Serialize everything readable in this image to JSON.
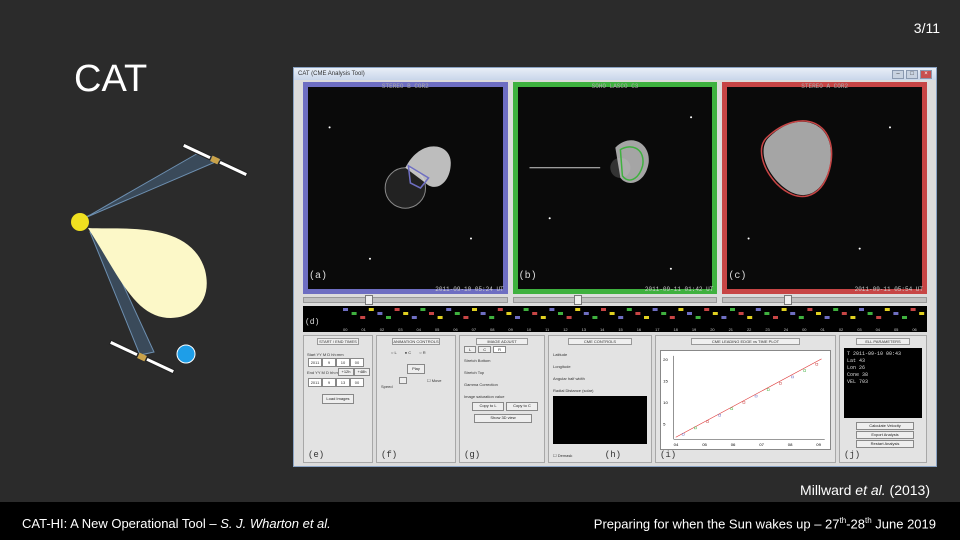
{
  "slide": {
    "number": "3/11",
    "title": "CAT"
  },
  "app": {
    "window_title": "CAT (CME Analysis Tool)",
    "panels": [
      {
        "title": "STEREO B COR2",
        "label": "(a)",
        "date": "2011-09-10 05:24 UT",
        "color": "#6e6ec2"
      },
      {
        "title": "SOHO LASCO C3",
        "label": "(b)",
        "date": "2011-09-11 01:42 UT",
        "color": "#3fb13f"
      },
      {
        "title": "STEREO A COR2",
        "label": "(c)",
        "date": "2011-09-11 05:54 UT",
        "color": "#c74545"
      }
    ],
    "timeline_label": "(d)",
    "timeline_ticks": [
      "00",
      "01",
      "02",
      "03",
      "04",
      "05",
      "06",
      "07",
      "08",
      "09",
      "10",
      "11",
      "12",
      "13",
      "14",
      "15",
      "16",
      "17",
      "18",
      "19",
      "20",
      "21",
      "22",
      "23",
      "24",
      "00",
      "01",
      "02",
      "03",
      "04",
      "05",
      "06"
    ],
    "controls": {
      "start_end": {
        "header": "START / END TIMES",
        "label": "(e)",
        "start_label": "Start YY M D hh:mm",
        "end_label": "End YY M D hh:mm",
        "start_values": [
          "2011",
          "9",
          "10",
          "00"
        ],
        "end_values": [
          "2011",
          "9",
          "13",
          "00"
        ],
        "btn1": "+12h",
        "btn2": "+48h",
        "load_button": "Load Images"
      },
      "animation": {
        "header": "ANIMATION CONTROLS",
        "label": "(f)",
        "radio_l": "L",
        "radio_c": "C",
        "radio_r": "R",
        "play_button": "Play",
        "speed_label": "Speed",
        "check_label": "Move"
      },
      "image_adjust": {
        "header": "IMAGE ADJUST",
        "label": "(g)",
        "tabs": [
          "L",
          "C",
          "R"
        ],
        "stretch_bottom": "Stretch Bottom",
        "stretch_top": "Stretch Top",
        "gamma": "Gamma Correction",
        "saturation": "Image saturation value",
        "copy_l": "Copy to L",
        "copy_c": "Copy to C",
        "show_3d": "Show 3D view"
      },
      "cme_controls": {
        "header": "CME CONTROLS",
        "label": "(h)",
        "latitude": "Latitude",
        "longitude": "Longitude",
        "half_angle": "Angular half width",
        "distance": "Radial Distance (solar)",
        "check_label": "Demask"
      },
      "plot": {
        "header": "CME LEADING EDGE vs TIME PLOT",
        "label": "(i)",
        "x_ticks": [
          "04",
          "05",
          "06",
          "07",
          "08",
          "09"
        ],
        "y_ticks": [
          "20",
          "15",
          "10",
          "5"
        ]
      },
      "ellipse": {
        "header": "ELL PARAMETERS",
        "label": "(j)",
        "lines": [
          "T  2011-09-10 00:43",
          "Lat  43",
          "Lon  26",
          "Cone  38",
          "VEL  703"
        ],
        "btn1": "Calculate Velocity",
        "btn2": "Export Analysis",
        "btn3": "Restart Analysis"
      }
    }
  },
  "citation": {
    "author": "Millward ",
    "etal": "et al.",
    "year": " (2013)"
  },
  "footer": {
    "left_prefix": "CAT-HI: A New Operational Tool – ",
    "left_italic": "S. J. Wharton et al.",
    "right_prefix": "Preparing for when the Sun wakes up – 27",
    "right_sup1": "th",
    "right_mid": "-28",
    "right_sup2": "th",
    "right_suffix": " June 2019"
  }
}
